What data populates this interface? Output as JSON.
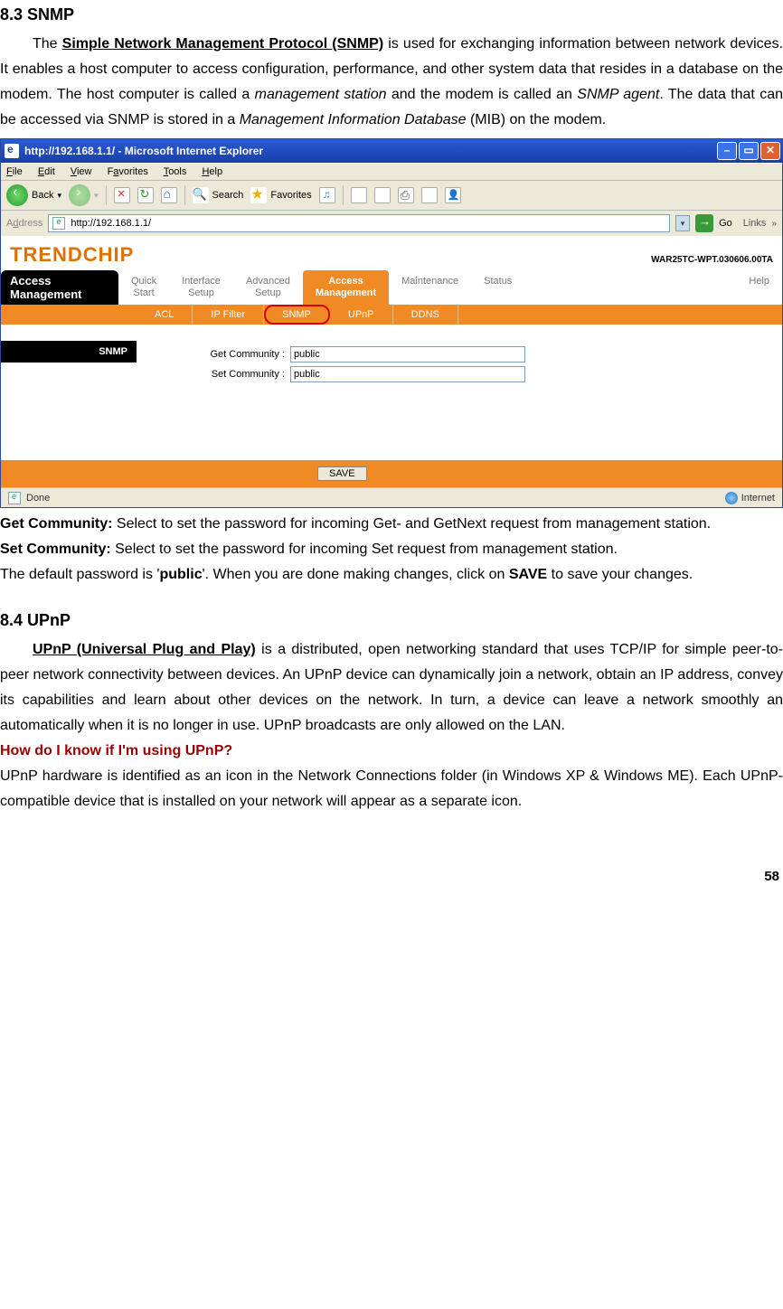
{
  "section1": {
    "heading": "8.3  SNMP",
    "para": "The ",
    "link": "Simple Network Management Protocol (SNMP)",
    "rest": " is used for exchanging information between network devices. It enables a host computer to access configuration, performance, and other system data that resides in a database on the modem. The host computer is called a ",
    "em1": "management station",
    "mid": " and the modem is called an ",
    "em2": "SNMP agent",
    "tail": ". The data that can be accessed via SNMP is stored in a ",
    "em3": "Management Information Database",
    "tail2": " (MIB) on the modem."
  },
  "browser": {
    "title": "http://192.168.1.1/ - Microsoft Internet Explorer",
    "menu": {
      "file": "File",
      "edit": "Edit",
      "view": "View",
      "favorites": "Favorites",
      "tools": "Tools",
      "help": "Help"
    },
    "toolbar": {
      "back": "Back",
      "search": "Search",
      "favorites": "Favorites"
    },
    "address_label": "Address",
    "url": "http://192.168.1.1/",
    "go": "Go",
    "links": "Links",
    "status_done": "Done",
    "status_zone": "Internet"
  },
  "router": {
    "brand": "TRENDCHIP",
    "firmware": "WAR25TC-WPT.030606.00TA",
    "current_section": "Access Management",
    "maintabs": {
      "quick": "Quick\nStart",
      "iface": "Interface\nSetup",
      "adv": "Advanced\nSetup",
      "access": "Access\nManagement",
      "maint": "Maintenance",
      "status": "Status",
      "help": "Help"
    },
    "subtabs": {
      "acl": "ACL",
      "ipf": "IP Filter",
      "snmp": "SNMP",
      "upnp": "UPnP",
      "ddns": "DDNS"
    },
    "snmp_heading": "SNMP",
    "get_label": "Get Community :",
    "set_label": "Set Community :",
    "get_value": "public",
    "set_value": "public",
    "save": "SAVE"
  },
  "after": {
    "get_b": "Get Community:",
    "get_t": " Select to set the password for incoming Get- and GetNext request from management station.",
    "set_b": "Set Community:",
    "set_t": " Select to set the password for incoming Set request from management station.",
    "def1": "The default password is '",
    "def_pw": "public",
    "def2": "'. When you are done making changes, click on ",
    "save": "SAVE",
    "def3": " to save your changes."
  },
  "section2": {
    "heading": "8.4 UPnP",
    "link": "UPnP (Universal Plug and Play)",
    "p1": " is a distributed, open networking standard that uses TCP/IP for simple peer-to-peer network connectivity between devices. An UPnP device can dynamically join a network, obtain an IP address, convey its capabilities and learn about other devices on the network. In turn, a device can leave a network smoothly an automatically when it is no longer in use. UPnP broadcasts are only allowed on the LAN.",
    "q": "How do I know if I'm using UPnP?",
    "p2": "UPnP hardware is identified as an icon in the Network Connections folder (in Windows XP & Windows ME). Each UPnP-compatible device that is installed on your network will appear as a separate icon."
  },
  "page_number": "58"
}
